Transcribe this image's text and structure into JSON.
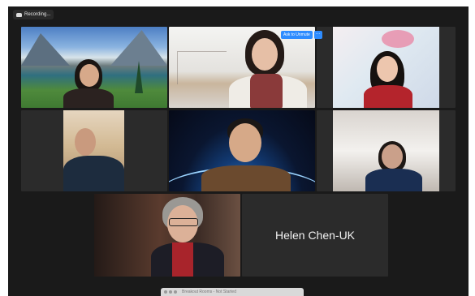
{
  "recording": {
    "label": "Recording..."
  },
  "unmute": {
    "label": "Ask to Unmute",
    "more": "···"
  },
  "participants": [
    {
      "id": "p1",
      "background": "lake"
    },
    {
      "id": "p2",
      "background": "window"
    },
    {
      "id": "p3",
      "background": "blossom"
    },
    {
      "id": "p4",
      "background": "room"
    },
    {
      "id": "p5",
      "background": "space"
    },
    {
      "id": "p6",
      "background": "wall"
    },
    {
      "id": "p7",
      "background": "dark"
    },
    {
      "id": "p8",
      "name": "Helen Chen-UK"
    }
  ],
  "breakout_bar": {
    "label": "Breakout Rooms - Not Started"
  },
  "colors": {
    "accent": "#2d8cff",
    "window_bg": "#1a1a1a",
    "tile_bg": "#2b2b2b"
  }
}
